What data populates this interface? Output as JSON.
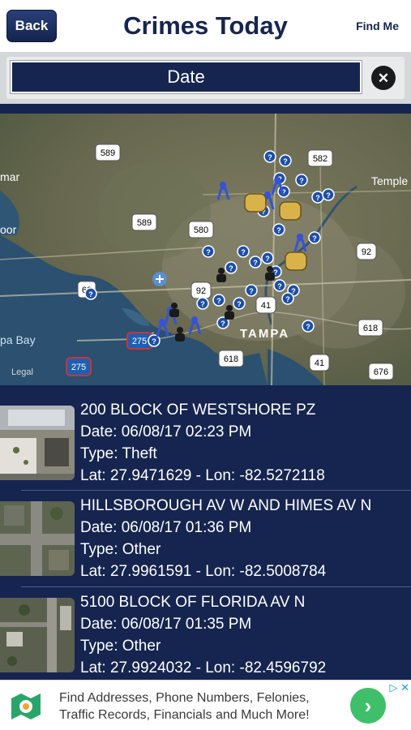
{
  "header": {
    "back_label": "Back",
    "title": "Crimes Today",
    "find_me_label": "Find Me"
  },
  "filter": {
    "date_label": "Date",
    "clear_icon": "close-circle-icon",
    "clear_glyph": "✕"
  },
  "map": {
    "legal_label": "Legal",
    "city_label": "TAMPA",
    "place_labels": {
      "mar": "mar",
      "oor": "oor",
      "bay": "pa Bay",
      "temple": "Temple"
    },
    "route_shields": [
      "589",
      "582",
      "589",
      "580",
      "92",
      "92",
      "60",
      "41",
      "618",
      "275",
      "618",
      "41",
      "676",
      "275"
    ]
  },
  "crimes": [
    {
      "address": "200 BLOCK OF WESTSHORE PZ",
      "date": "Date: 06/08/17 02:23 PM",
      "type": "Type: Theft",
      "coords": "Lat: 27.9471629 - Lon: -82.5272118"
    },
    {
      "address": "HILLSBOROUGH AV W AND HIMES AV N",
      "date": "Date: 06/08/17 01:36 PM",
      "type": "Type: Other",
      "coords": "Lat: 27.9961591 - Lon: -82.5008784"
    },
    {
      "address": "5100 BLOCK OF FLORIDA AV N",
      "date": "Date: 06/08/17 01:35 PM",
      "type": "Type: Other",
      "coords": "Lat: 27.9924032 - Lon: -82.4596792"
    }
  ],
  "ad": {
    "line1": "Find Addresses, Phone Numbers, Felonies,",
    "line2": "Traffic Records, Financials and Much More!",
    "go_glyph": "›",
    "choices_glyph": "▷ ✕"
  },
  "colors": {
    "navy": "#16254f",
    "accent_green": "#3fbf6a",
    "map_water": "#2b5070",
    "pin_blue": "#1e4fa6"
  }
}
